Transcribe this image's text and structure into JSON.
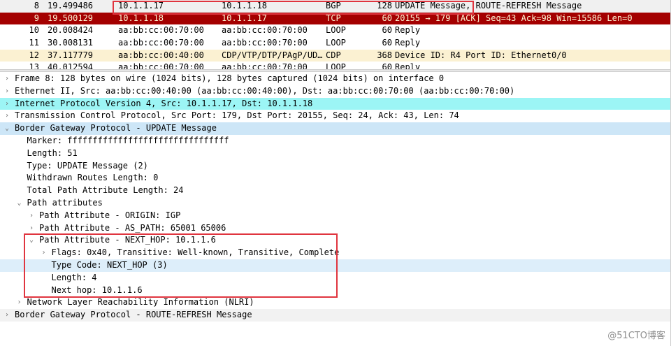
{
  "packets": [
    {
      "no": "8",
      "time": "19.499486",
      "src": "10.1.1.17",
      "dst": "10.1.1.18",
      "proto": "BGP",
      "len": "128",
      "info": "UPDATE Message, ROUTE-REFRESH Message",
      "style": "selected"
    },
    {
      "no": "9",
      "time": "19.500129",
      "src": "10.1.1.18",
      "dst": "10.1.1.17",
      "proto": "TCP",
      "len": "60",
      "info": "20155 → 179 [ACK] Seq=43 Ack=98 Win=15586 Len=0",
      "style": "red"
    },
    {
      "no": "10",
      "time": "20.008424",
      "src": "aa:bb:cc:00:70:00",
      "dst": "aa:bb:cc:00:70:00",
      "proto": "LOOP",
      "len": "60",
      "info": "Reply",
      "style": "white"
    },
    {
      "no": "11",
      "time": "30.008131",
      "src": "aa:bb:cc:00:70:00",
      "dst": "aa:bb:cc:00:70:00",
      "proto": "LOOP",
      "len": "60",
      "info": "Reply",
      "style": "white"
    },
    {
      "no": "12",
      "time": "37.117779",
      "src": "aa:bb:cc:00:40:00",
      "dst": "CDP/VTP/DTP/PAgP/UD…",
      "proto": "CDP",
      "len": "368",
      "info": "Device ID: R4  Port ID: Ethernet0/0",
      "style": "cdp"
    },
    {
      "no": "13",
      "time": "40.012594",
      "src": "aa:bb:cc:00:70:00",
      "dst": "aa:bb:cc:00:70:00",
      "proto": "LOOP",
      "len": "60",
      "info": "Reply",
      "style": "white"
    }
  ],
  "details": [
    {
      "indent": 0,
      "arrow": "›",
      "text": "Frame 8: 128 bytes on wire (1024 bits), 128 bytes captured (1024 bits) on interface 0",
      "hl": ""
    },
    {
      "indent": 0,
      "arrow": "›",
      "text": "Ethernet II, Src: aa:bb:cc:00:40:00 (aa:bb:cc:00:40:00), Dst: aa:bb:cc:00:70:00 (aa:bb:cc:00:70:00)",
      "hl": ""
    },
    {
      "indent": 0,
      "arrow": "›",
      "text": "Internet Protocol Version 4, Src: 10.1.1.17, Dst: 10.1.1.18",
      "hl": "cyan"
    },
    {
      "indent": 0,
      "arrow": "›",
      "text": "Transmission Control Protocol, Src Port: 179, Dst Port: 20155, Seq: 24, Ack: 43, Len: 74",
      "hl": ""
    },
    {
      "indent": 0,
      "arrow": "⌄",
      "text": "Border Gateway Protocol - UPDATE Message",
      "hl": "blue"
    },
    {
      "indent": 1,
      "arrow": "",
      "text": "Marker: ffffffffffffffffffffffffffffffff",
      "hl": ""
    },
    {
      "indent": 1,
      "arrow": "",
      "text": "Length: 51",
      "hl": ""
    },
    {
      "indent": 1,
      "arrow": "",
      "text": "Type: UPDATE Message (2)",
      "hl": ""
    },
    {
      "indent": 1,
      "arrow": "",
      "text": "Withdrawn Routes Length: 0",
      "hl": ""
    },
    {
      "indent": 1,
      "arrow": "",
      "text": "Total Path Attribute Length: 24",
      "hl": ""
    },
    {
      "indent": 1,
      "arrow": "⌄",
      "text": "Path attributes",
      "hl": ""
    },
    {
      "indent": 2,
      "arrow": "›",
      "text": "Path Attribute - ORIGIN: IGP",
      "hl": ""
    },
    {
      "indent": 2,
      "arrow": "›",
      "text": "Path Attribute - AS_PATH: 65001 65006",
      "hl": ""
    },
    {
      "indent": 2,
      "arrow": "⌄",
      "text": "Path Attribute - NEXT_HOP: 10.1.1.6",
      "hl": ""
    },
    {
      "indent": 3,
      "arrow": "›",
      "text": "Flags: 0x40, Transitive: Well-known, Transitive, Complete",
      "hl": ""
    },
    {
      "indent": 3,
      "arrow": "",
      "text": "Type Code: NEXT_HOP (3)",
      "hl": "lightblue"
    },
    {
      "indent": 3,
      "arrow": "",
      "text": "Length: 4",
      "hl": ""
    },
    {
      "indent": 3,
      "arrow": "",
      "text": "Next hop: 10.1.1.6",
      "hl": ""
    },
    {
      "indent": 1,
      "arrow": "›",
      "text": "Network Layer Reachability Information (NLRI)",
      "hl": ""
    },
    {
      "indent": 0,
      "arrow": "›",
      "text": "Border Gateway Protocol - ROUTE-REFRESH Message",
      "hl": "gray"
    }
  ],
  "watermark": "@51CTO博客",
  "colors": {
    "annotation_red": "#e0353f",
    "tcp_row": "#a40000",
    "ip_highlight": "#9cf5f5"
  }
}
